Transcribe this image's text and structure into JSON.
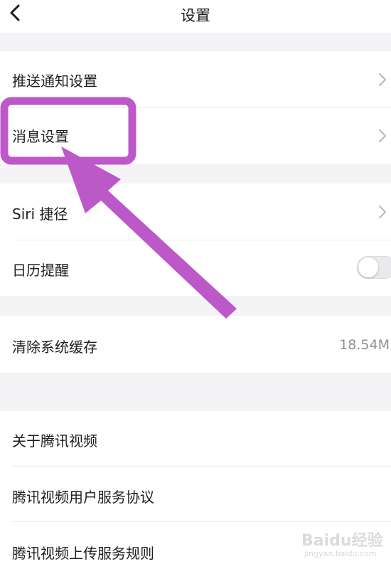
{
  "nav": {
    "title": "设置",
    "back_icon": "chevron-left-icon"
  },
  "sections": {
    "notifications": {
      "push_label": "推送通知设置",
      "message_label": "消息设置"
    },
    "shortcuts": {
      "siri_label": "Siri 捷径",
      "calendar_label": "日历提醒",
      "calendar_enabled": false
    },
    "storage": {
      "cache_label": "清除系统缓存",
      "cache_value": "18.54M"
    },
    "about": {
      "about_label": "关于腾讯视频",
      "user_agreement_label": "腾讯视频用户服务协议",
      "upload_rules_label": "腾讯视频上传服务规则"
    }
  },
  "annotation": {
    "highlight_color": "#bd58c9",
    "highlighted_item": "消息设置"
  },
  "watermark": {
    "brand": "Baidu经验",
    "url": "jingyan.baidu.com"
  }
}
